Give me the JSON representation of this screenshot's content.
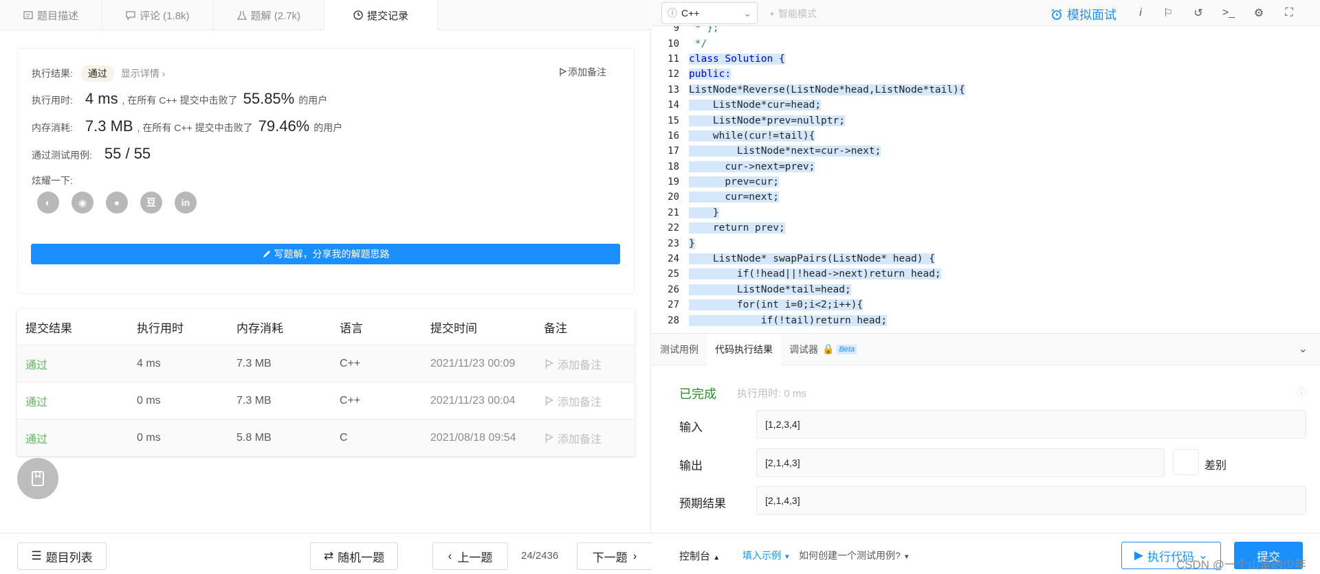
{
  "left": {
    "tabs": [
      {
        "label": "题目描述"
      },
      {
        "label": "评论 (1.8k)"
      },
      {
        "label": "题解 (2.7k)"
      },
      {
        "label": "提交记录"
      }
    ],
    "result": {
      "result_label": "执行结果:",
      "result_value": "通过",
      "details_link": "显示详情 ›",
      "add_note": "添加备注",
      "time_label": "执行用时:",
      "time_value": "4 ms",
      "time_mid": ", 在所有 C++ 提交中击败了",
      "time_pct": "55.85%",
      "time_suffix": "的用户",
      "mem_label": "内存消耗:",
      "mem_value": "7.3 MB",
      "mem_mid": ", 在所有 C++ 提交中击败了",
      "mem_pct": "79.46%",
      "mem_suffix": "的用户",
      "tests_label": "通过测试用例:",
      "tests_value": "55 / 55",
      "share_label": "炫耀一下:",
      "share_icons": [
        "wechat-icon",
        "weibo-icon",
        "qq-icon",
        "douban-icon",
        "linkedin-icon"
      ],
      "write_button": "写题解，分享我的解题思路"
    },
    "table": {
      "headers": [
        "提交结果",
        "执行用时",
        "内存消耗",
        "语言",
        "提交时间",
        "备注"
      ],
      "rows": [
        {
          "status": "通过",
          "time": "4 ms",
          "memory": "7.3 MB",
          "lang": "C++",
          "submitted": "2021/11/23 00:09",
          "note": "添加备注"
        },
        {
          "status": "通过",
          "time": "0 ms",
          "memory": "7.3 MB",
          "lang": "C++",
          "submitted": "2021/11/23 00:04",
          "note": "添加备注"
        },
        {
          "status": "通过",
          "time": "0 ms",
          "memory": "5.8 MB",
          "lang": "C",
          "submitted": "2021/08/18 09:54",
          "note": "添加备注"
        }
      ]
    },
    "footer": {
      "problem_list": "题目列表",
      "random": "随机一题",
      "prev": "上一题",
      "pager": "24/2436",
      "next": "下一题"
    }
  },
  "right": {
    "language": "C++",
    "smart_mode": "智能模式",
    "mock_interview": "模拟面试",
    "toolbar_icons": [
      "info-icon",
      "flag-icon",
      "reset-icon",
      "terminal-icon",
      "settings-icon",
      "fullscreen-icon"
    ],
    "code_lines": [
      {
        "n": "9",
        "t": " * };"
      },
      {
        "n": "10",
        "t": " */"
      },
      {
        "n": "11",
        "t": "class Solution {"
      },
      {
        "n": "12",
        "t": "public:"
      },
      {
        "n": "13",
        "t": "ListNode*Reverse(ListNode*head,ListNode*tail){"
      },
      {
        "n": "14",
        "t": "    ListNode*cur=head;"
      },
      {
        "n": "15",
        "t": "    ListNode*prev=nullptr;"
      },
      {
        "n": "16",
        "t": "    while(cur!=tail){"
      },
      {
        "n": "17",
        "t": "        ListNode*next=cur->next;"
      },
      {
        "n": "18",
        "t": "      cur->next=prev;"
      },
      {
        "n": "19",
        "t": "      prev=cur;"
      },
      {
        "n": "20",
        "t": "      cur=next;"
      },
      {
        "n": "21",
        "t": "    }"
      },
      {
        "n": "22",
        "t": "    return prev;"
      },
      {
        "n": "23",
        "t": "}"
      },
      {
        "n": "24",
        "t": "    ListNode* swapPairs(ListNode* head) {"
      },
      {
        "n": "25",
        "t": "        if(!head||!head->next)return head;"
      },
      {
        "n": "26",
        "t": "        ListNode*tail=head;"
      },
      {
        "n": "27",
        "t": "        for(int i=0;i<2;i++){"
      },
      {
        "n": "28",
        "t": "            if(!tail)return head;"
      }
    ],
    "console_tabs": [
      {
        "label": "测试用例"
      },
      {
        "label": "代码执行结果"
      },
      {
        "label": "调试器"
      }
    ],
    "beta": "Beta",
    "console": {
      "status": "已完成",
      "run_time": "执行用时: 0 ms",
      "input_label": "输入",
      "input_value": "[1,2,3,4]",
      "output_label": "输出",
      "output_value": "[2,1,4,3]",
      "expected_label": "预期结果",
      "expected_value": "[2,1,4,3]",
      "diff_label": "差别"
    },
    "footer": {
      "console": "控制台",
      "fill_example": "填入示例",
      "how_to": "如何创建一个测试用例?",
      "run": "执行代码",
      "submit": "提交"
    },
    "watermark": "CSDN @一个山里的少年"
  },
  "colors": {
    "accent": "#1a90ff",
    "pass": "#5cb85c",
    "code_selection": "#d4e7fb"
  }
}
